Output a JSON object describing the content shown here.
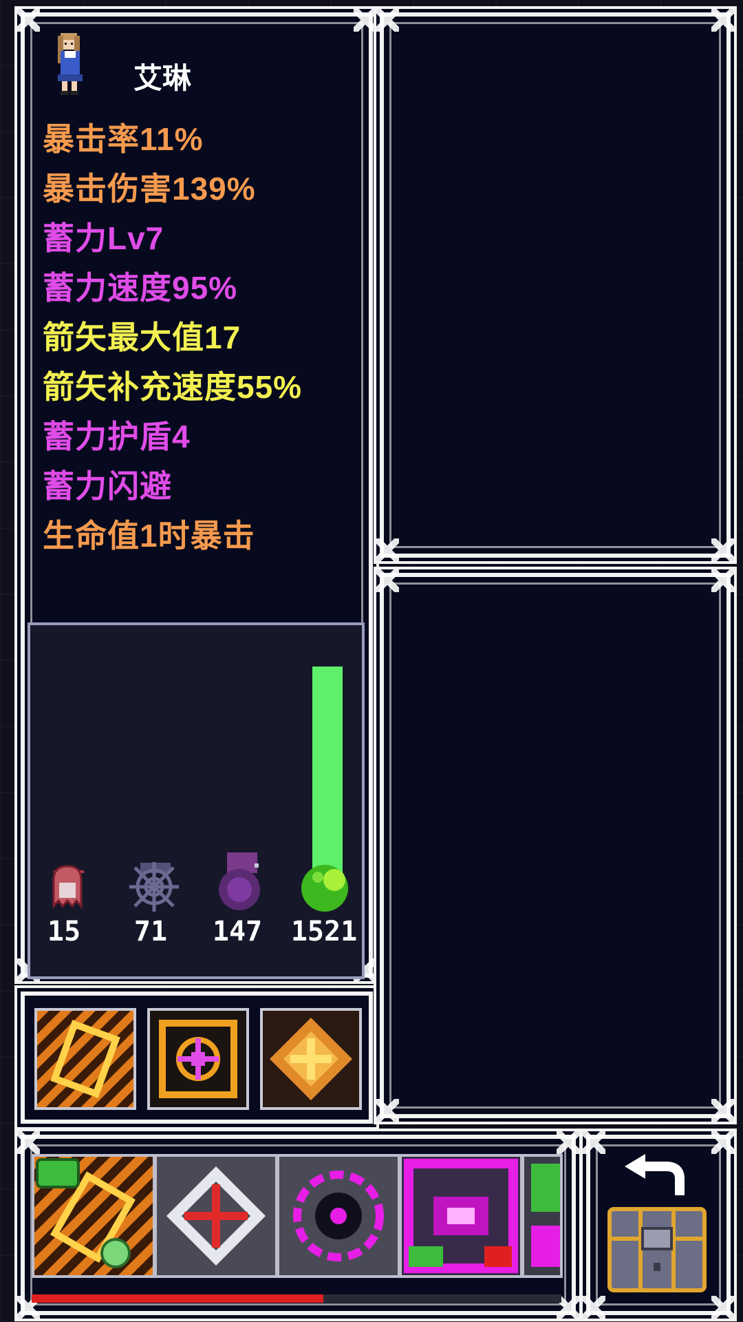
{
  "character": {
    "name": "艾琳",
    "stats": [
      {
        "text": "暴击率11%",
        "color": "#f59a4e"
      },
      {
        "text": "暴击伤害139%",
        "color": "#f59a4e"
      },
      {
        "text": "蓄力Lv7",
        "color": "#e04ce8"
      },
      {
        "text": "蓄力速度95%",
        "color": "#e04ce8"
      },
      {
        "text": "箭矢最大值17",
        "color": "#f2f050"
      },
      {
        "text": "箭矢补充速度55%",
        "color": "#f2f050"
      },
      {
        "text": "蓄力护盾4",
        "color": "#e04ce8"
      },
      {
        "text": "蓄力闪避",
        "color": "#e04ce8"
      },
      {
        "text": "生命值1时暴击",
        "color": "#f59a4e"
      }
    ]
  },
  "resources": [
    {
      "icon": "ghost-icon",
      "count": "15",
      "level": 0.01,
      "color": "#b23a4a"
    },
    {
      "icon": "spiderweb-icon",
      "count": "71",
      "level": 0.05,
      "color": "#55507a"
    },
    {
      "icon": "dark-orb-icon",
      "count": "147",
      "level": 0.1,
      "color": "#7a3a8a"
    },
    {
      "icon": "slime-icon",
      "count": "1521",
      "level": 1.0,
      "color": "#5ef06a"
    }
  ],
  "equipment": [
    {
      "icon": "scroll-card-icon"
    },
    {
      "icon": "target-gem-icon"
    },
    {
      "icon": "shuriken-card-icon"
    }
  ],
  "items": [
    {
      "icon": "scroll-coin-icon"
    },
    {
      "icon": "crosshair-icon"
    },
    {
      "icon": "magenta-ring-icon"
    },
    {
      "icon": "swap-rune-icon"
    },
    {
      "icon": "partial-rune-icon"
    }
  ],
  "health": {
    "fraction": 0.55
  },
  "chest": {
    "icon": "treasure-chest-icon",
    "back_icon": "undo-arrow-icon"
  }
}
